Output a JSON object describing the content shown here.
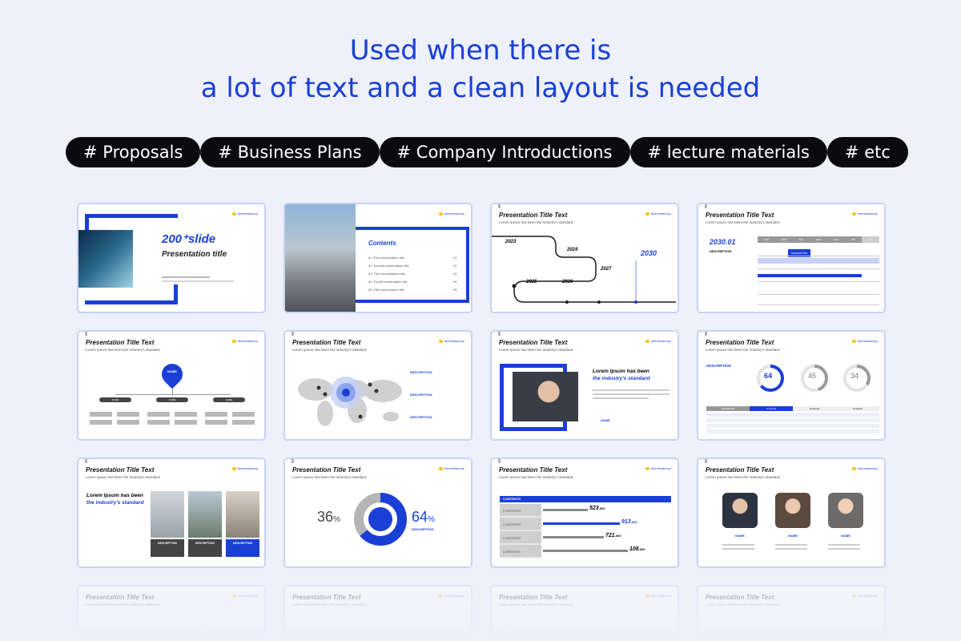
{
  "headline": {
    "line1": "Used when there is",
    "line2": "a lot of text and a clean layout is needed"
  },
  "tags": [
    "# Proposals",
    "# Business Plans",
    "# Company Introductions",
    "# lecture materials",
    "# etc"
  ],
  "colors": {
    "accent": "#1a3fd6",
    "tag_bg": "#0b0b0f",
    "page_bg": "#eef1fb",
    "slide_border": "#c9d2f3"
  },
  "slide_title": "Presentation Title Text",
  "slide_subtitle": "Lorem Ipsum has been the industry's standard.",
  "brand": "themesfactory",
  "slides": {
    "cover": {
      "big": "200⁺slide",
      "sub": "Presentation title"
    },
    "contents": {
      "heading": "Contents",
      "items": [
        "01. First presentation title",
        "02. Second presentation title",
        "03. Third presentation title",
        "04. Fourth presentation title",
        "05. Fifth presentation title"
      ],
      "nums": [
        "01",
        "02",
        "03",
        "04",
        "05"
      ]
    },
    "timeline": {
      "years": [
        "2023",
        "2024",
        "2025",
        "2026",
        "2027",
        "2030"
      ]
    },
    "calendar": {
      "year": "2030.01",
      "label": "DESCRIPTION",
      "days": [
        "SUN",
        "MON",
        "TUE",
        "WED",
        "THU",
        "FRI",
        "SAT"
      ],
      "event": "DESCRIPTION"
    },
    "org": {
      "top": "NAME",
      "mids": [
        "NAME",
        "NAME",
        "NAME"
      ]
    },
    "map": {
      "labels": [
        "DESCRIPTION",
        "DESCRIPTION",
        "DESCRIPTION"
      ]
    },
    "profile": {
      "headline1": "Lorem Ipsum has been",
      "headline2": "the industry's standard",
      "name": "NAME"
    },
    "stats": {
      "label": "DESCRIPTION",
      "p1": "64",
      "p2": "45",
      "p3": "34",
      "cols": [
        "CONTENTS",
        "Contents",
        "Contents",
        "Contents"
      ]
    },
    "photos": {
      "headline1": "Lorem Ipsum has been",
      "headline2": "the industry's standard",
      "caps": [
        "DESCRIPTION",
        "DESCRIPTION",
        "DESCRIPTION"
      ]
    },
    "donut": {
      "left": "36",
      "right": "64",
      "unit": "%",
      "label": "DESCRIPTION"
    },
    "gantt": {
      "header": "CONTENTS",
      "vals": [
        "523",
        "913",
        "721",
        "108"
      ],
      "unit": ",000",
      "row": "CONTENTS"
    },
    "team": {
      "names": [
        "NAME",
        "NAME",
        "NAME"
      ]
    }
  }
}
